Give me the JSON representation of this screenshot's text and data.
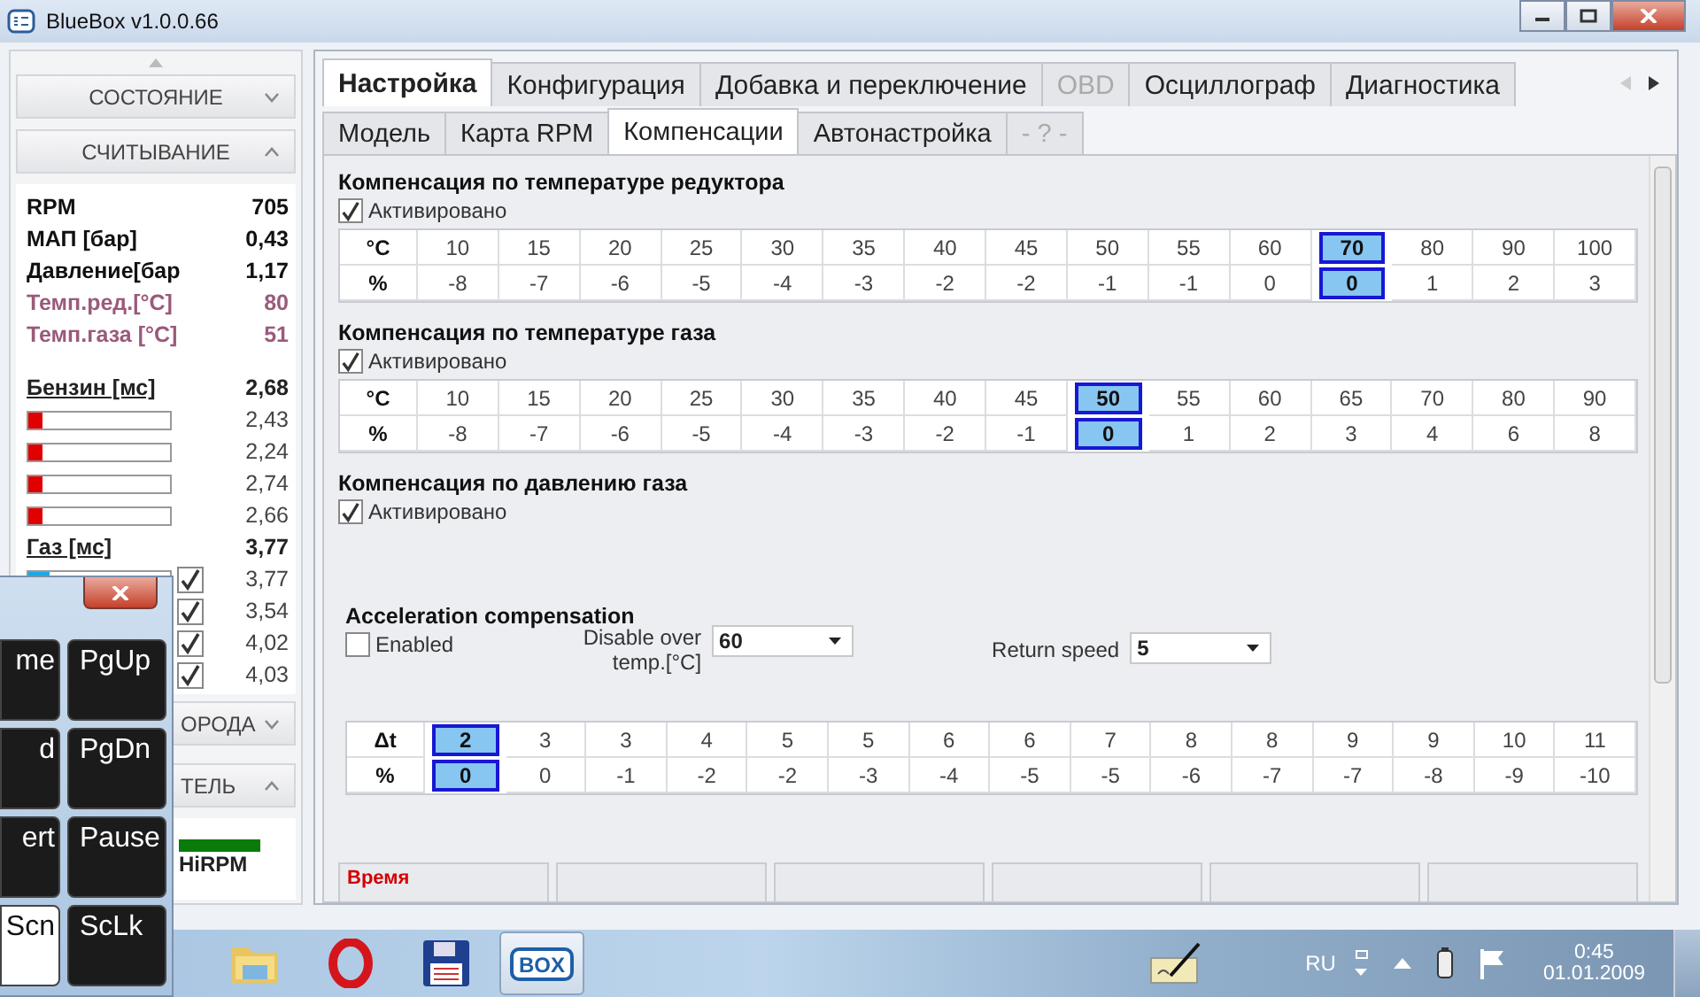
{
  "window": {
    "title": "BlueBox v1.0.0.66"
  },
  "sidebar": {
    "sections": [
      {
        "label": "СОСТОЯНИЕ",
        "expanded": false
      },
      {
        "label": "СЧИТЫВАНИЕ",
        "expanded": true
      }
    ],
    "readings": [
      {
        "label": "RPM",
        "value": "705",
        "color": "#111111"
      },
      {
        "label": "МАП [бар]",
        "value": "0,43",
        "color": "#111111"
      },
      {
        "label": "Давление[бар",
        "value": "1,17",
        "color": "#111111"
      },
      {
        "label": "Темп.ред.[°C]",
        "value": "80",
        "color": "#9a5a7c"
      },
      {
        "label": "Темп.газа [°C]",
        "value": "51",
        "color": "#9a5a7c"
      }
    ],
    "injector_groups": [
      {
        "kind": "petrol",
        "label": "Бензин [мс]",
        "value": "2,68",
        "injectors": [
          {
            "level": 0.1,
            "value": "2,43"
          },
          {
            "level": 0.1,
            "value": "2,24"
          },
          {
            "level": 0.1,
            "value": "2,74"
          },
          {
            "level": 0.1,
            "value": "2,66"
          }
        ]
      },
      {
        "kind": "gas",
        "label": "Газ [мс]",
        "value": "3,77",
        "injectors": [
          {
            "level": 0.15,
            "checked": true,
            "value": "3,77"
          },
          {
            "checked": true,
            "value": "3,54"
          },
          {
            "checked": true,
            "value": "4,02"
          },
          {
            "checked": true,
            "value": "4,03"
          }
        ]
      }
    ],
    "lower_sections": [
      {
        "label": "ОРОДА",
        "expanded": false
      },
      {
        "label": "ТЕЛЬ",
        "expanded": true
      }
    ],
    "indicators": [
      {
        "label": "HiRPM",
        "on": true
      }
    ]
  },
  "tabs": [
    {
      "label": "Настройка",
      "selected": true,
      "disabled": false
    },
    {
      "label": "Конфигурация",
      "selected": false,
      "disabled": false
    },
    {
      "label": "Добавка и переключение",
      "selected": false,
      "disabled": false
    },
    {
      "label": "OBD",
      "selected": false,
      "disabled": true
    },
    {
      "label": "Осциллограф",
      "selected": false,
      "disabled": false
    },
    {
      "label": "Диагностика",
      "selected": false,
      "disabled": false
    }
  ],
  "subtabs": [
    {
      "label": "Модель",
      "selected": false,
      "disabled": false
    },
    {
      "label": "Карта RPM",
      "selected": false,
      "disabled": false
    },
    {
      "label": "Компенсации",
      "selected": true,
      "disabled": false
    },
    {
      "label": "Автонастройка",
      "selected": false,
      "disabled": false
    },
    {
      "label": "- ? -",
      "selected": false,
      "disabled": true
    }
  ],
  "sections": [
    {
      "title": "Компенсация по температуре редуктора",
      "checkbox": {
        "label": "Активировано",
        "checked": true
      },
      "table": {
        "headers": [
          "°C",
          "%"
        ],
        "columns": [
          {
            "values": [
              "10",
              "-8"
            ],
            "selected": false
          },
          {
            "values": [
              "15",
              "-7"
            ],
            "selected": false
          },
          {
            "values": [
              "20",
              "-6"
            ],
            "selected": false
          },
          {
            "values": [
              "25",
              "-5"
            ],
            "selected": false
          },
          {
            "values": [
              "30",
              "-4"
            ],
            "selected": false
          },
          {
            "values": [
              "35",
              "-3"
            ],
            "selected": false
          },
          {
            "values": [
              "40",
              "-2"
            ],
            "selected": false
          },
          {
            "values": [
              "45",
              "-2"
            ],
            "selected": false
          },
          {
            "values": [
              "50",
              "-1"
            ],
            "selected": false
          },
          {
            "values": [
              "55",
              "-1"
            ],
            "selected": false
          },
          {
            "values": [
              "60",
              "0"
            ],
            "selected": false
          },
          {
            "values": [
              "70",
              "0"
            ],
            "selected": true
          },
          {
            "values": [
              "80",
              "1"
            ],
            "selected": false
          },
          {
            "values": [
              "90",
              "2"
            ],
            "selected": false
          },
          {
            "values": [
              "100",
              "3"
            ],
            "selected": false
          }
        ]
      }
    },
    {
      "title": "Компенсация по температуре газа",
      "checkbox": {
        "label": "Активировано",
        "checked": true
      },
      "table": {
        "headers": [
          "°C",
          "%"
        ],
        "columns": [
          {
            "values": [
              "10",
              "-8"
            ],
            "selected": false
          },
          {
            "values": [
              "15",
              "-7"
            ],
            "selected": false
          },
          {
            "values": [
              "20",
              "-6"
            ],
            "selected": false
          },
          {
            "values": [
              "25",
              "-5"
            ],
            "selected": false
          },
          {
            "values": [
              "30",
              "-4"
            ],
            "selected": false
          },
          {
            "values": [
              "35",
              "-3"
            ],
            "selected": false
          },
          {
            "values": [
              "40",
              "-2"
            ],
            "selected": false
          },
          {
            "values": [
              "45",
              "-1"
            ],
            "selected": false
          },
          {
            "values": [
              "50",
              "0"
            ],
            "selected": true
          },
          {
            "values": [
              "55",
              "1"
            ],
            "selected": false
          },
          {
            "values": [
              "60",
              "2"
            ],
            "selected": false
          },
          {
            "values": [
              "65",
              "3"
            ],
            "selected": false
          },
          {
            "values": [
              "70",
              "4"
            ],
            "selected": false
          },
          {
            "values": [
              "80",
              "6"
            ],
            "selected": false
          },
          {
            "values": [
              "90",
              "8"
            ],
            "selected": false
          }
        ]
      }
    },
    {
      "title": "Компенсация по давлению газа",
      "checkbox": {
        "label": "Активировано",
        "checked": true
      }
    },
    {
      "title": "Acceleration compensation",
      "checkbox": {
        "label": "Enabled",
        "checked": false
      },
      "dropdowns": [
        {
          "label": "Disable over temp.[°C]",
          "value": "60"
        },
        {
          "label": "Return speed",
          "value": "5"
        }
      ],
      "table": {
        "headers": [
          "Δt",
          "%"
        ],
        "columns": [
          {
            "values": [
              "2",
              "0"
            ],
            "selected": true
          },
          {
            "values": [
              "3",
              "0"
            ],
            "selected": false
          },
          {
            "values": [
              "3",
              "-1"
            ],
            "selected": false
          },
          {
            "values": [
              "4",
              "-2"
            ],
            "selected": false
          },
          {
            "values": [
              "5",
              "-2"
            ],
            "selected": false
          },
          {
            "values": [
              "5",
              "-3"
            ],
            "selected": false
          },
          {
            "values": [
              "6",
              "-4"
            ],
            "selected": false
          },
          {
            "values": [
              "6",
              "-5"
            ],
            "selected": false
          },
          {
            "values": [
              "7",
              "-5"
            ],
            "selected": false
          },
          {
            "values": [
              "8",
              "-6"
            ],
            "selected": false
          },
          {
            "values": [
              "8",
              "-7"
            ],
            "selected": false
          },
          {
            "values": [
              "9",
              "-7"
            ],
            "selected": false
          },
          {
            "values": [
              "9",
              "-8"
            ],
            "selected": false
          },
          {
            "values": [
              "10",
              "-9"
            ],
            "selected": false
          },
          {
            "values": [
              "11",
              "-10"
            ],
            "selected": false
          }
        ]
      }
    }
  ],
  "status_panels": [
    {
      "label": "Время"
    }
  ],
  "onscreen_keyboard": {
    "keys": [
      {
        "label": "me",
        "pressed": false
      },
      {
        "label": "PgUp",
        "pressed": false
      },
      {
        "label": "d",
        "pressed": false
      },
      {
        "label": "PgDn",
        "pressed": false
      },
      {
        "label": "ert",
        "pressed": false
      },
      {
        "label": "Pause",
        "pressed": false
      },
      {
        "label": "Scn",
        "pressed": true
      },
      {
        "label": "ScLk",
        "pressed": false
      }
    ]
  },
  "taskbar": {
    "apps": [
      {
        "kind": "folder",
        "active": false
      },
      {
        "kind": "ring",
        "active": false
      },
      {
        "kind": "floppy",
        "active": false
      },
      {
        "kind": "box",
        "label": "BOX",
        "active": true
      }
    ],
    "language": "RU",
    "time": "0:45",
    "date": "01.01.2009"
  }
}
